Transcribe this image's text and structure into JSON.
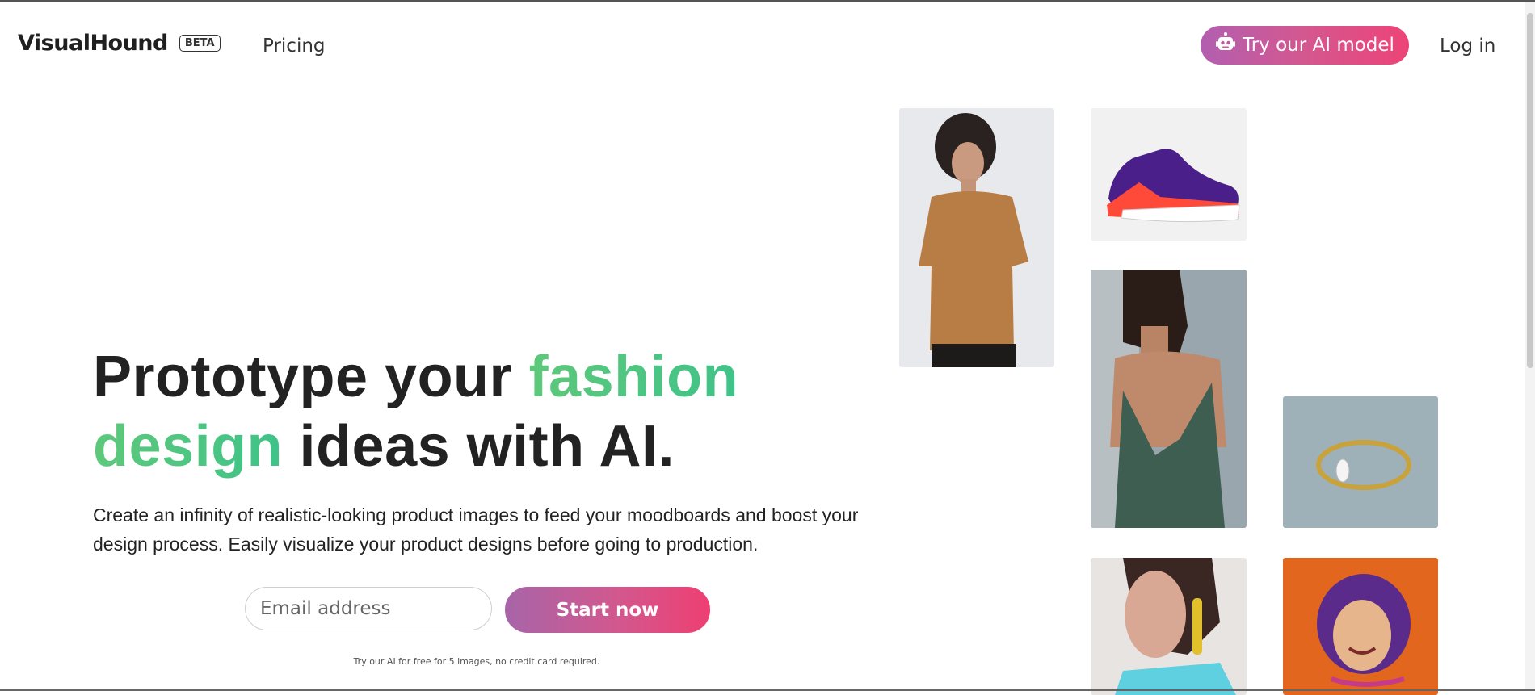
{
  "header": {
    "logo": "VisualHound",
    "badge": "BETA",
    "nav_pricing": "Pricing",
    "ai_button": "Try our AI model",
    "login": "Log in"
  },
  "hero": {
    "title_part1": "Prototype your ",
    "title_highlight1": "fashion",
    "title_highlight2": "design",
    "title_part2": " ideas with AI.",
    "subtitle": "Create an infinity of realistic-looking product images to feed your moodboards and boost your design process. Easily visualize your product designs before going to production."
  },
  "signup": {
    "email_placeholder": "Email address",
    "cta": "Start now",
    "note": "Try our AI for free for 5 images, no credit card required."
  },
  "gallery": [
    {
      "subject": "man-in-tshirt"
    },
    {
      "subject": "sneaker"
    },
    {
      "subject": "woman-in-green-dress"
    },
    {
      "subject": "gold-ring"
    },
    {
      "subject": "woman-with-earring"
    },
    {
      "subject": "purple-haired-woman"
    }
  ],
  "colors": {
    "accent_green": "#3fc389",
    "cta_gradient_start": "#a765a8",
    "cta_gradient_end": "#ee3f72"
  }
}
